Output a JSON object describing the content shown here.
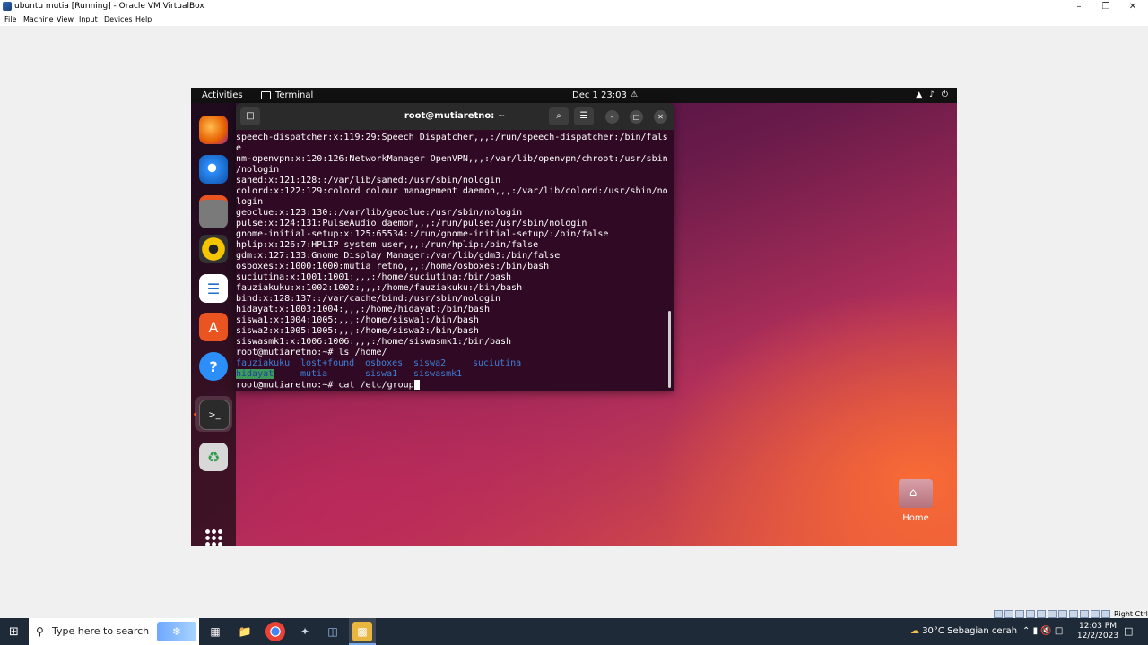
{
  "host": {
    "title": "ubuntu mutia [Running] - Oracle VM VirtualBox",
    "menu": [
      "File",
      "Machine",
      "View",
      "Input",
      "Devices",
      "Help"
    ],
    "host_key": "Right Ctrl"
  },
  "gnome": {
    "activities": "Activities",
    "app": "Terminal",
    "clock": "Dec 1  23:03"
  },
  "terminal": {
    "title": "root@mutiaretno: ~",
    "lines": [
      "speech-dispatcher:x:119:29:Speech Dispatcher,,,:/run/speech-dispatcher:/bin/fals",
      "e",
      "nm-openvpn:x:120:126:NetworkManager OpenVPN,,,:/var/lib/openvpn/chroot:/usr/sbin",
      "/nologin",
      "saned:x:121:128::/var/lib/saned:/usr/sbin/nologin",
      "colord:x:122:129:colord colour management daemon,,,:/var/lib/colord:/usr/sbin/no",
      "login",
      "geoclue:x:123:130::/var/lib/geoclue:/usr/sbin/nologin",
      "pulse:x:124:131:PulseAudio daemon,,,:/run/pulse:/usr/sbin/nologin",
      "gnome-initial-setup:x:125:65534::/run/gnome-initial-setup/:/bin/false",
      "hplip:x:126:7:HPLIP system user,,,:/run/hplip:/bin/false",
      "gdm:x:127:133:Gnome Display Manager:/var/lib/gdm3:/bin/false",
      "osboxes:x:1000:1000:mutia retno,,,:/home/osboxes:/bin/bash",
      "suciutina:x:1001:1001:,,,:/home/suciutina:/bin/bash",
      "fauziakuku:x:1002:1002:,,,:/home/fauziakuku:/bin/bash",
      "bind:x:128:137::/var/cache/bind:/usr/sbin/nologin",
      "hidayat:x:1003:1004:,,,:/home/hidayat:/bin/bash",
      "siswa1:x:1004:1005:,,,:/home/siswa1:/bin/bash",
      "siswa2:x:1005:1005:,,,:/home/siswa2:/bin/bash",
      "siswasmk1:x:1006:1006:,,,:/home/siswasmk1:/bin/bash",
      "root@mutiaretno:~# ls /home/"
    ],
    "ls_row1": [
      "fauziakuku",
      "lost+found",
      "osboxes",
      "siswa2",
      "suciutina"
    ],
    "ls_row2": [
      "hidayat",
      "mutia",
      "siswa1",
      "siswasmk1"
    ],
    "prompt": "root@mutiaretno:~# ",
    "command": "cat /etc/group"
  },
  "desktop": {
    "home_label": "Home"
  },
  "taskbar": {
    "search_placeholder": "Type here to search",
    "weather_temp": "30°C",
    "weather_desc": "Sebagian cerah",
    "time": "12:03 PM",
    "date": "12/2/2023"
  }
}
